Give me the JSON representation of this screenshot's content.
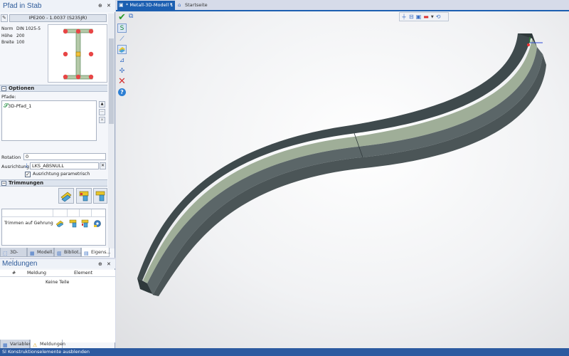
{
  "left_panel": {
    "title": "Pfad in Stab",
    "pin_glyph": "⊕",
    "close_glyph": "✕",
    "profile_name": "IPE200 - 1.0037 (S235JR)",
    "properties": [
      {
        "label": "Norm",
        "value": "DIN 1025-5"
      },
      {
        "label": "Höhe",
        "value": "200"
      },
      {
        "label": "Breite",
        "value": "100"
      }
    ],
    "options_header": "Optionen",
    "paths_label": "Pfade:",
    "paths": [
      "3D-Pfad_1"
    ],
    "rotation_label": "Rotation",
    "rotation_value": "0",
    "alignment_label": "Ausrichtung",
    "alignment_value": "LKS_ABSNULL",
    "parametric_label": "Ausrichtung parametrisch",
    "parametric_checked": true,
    "trims_header": "Trimmungen",
    "trim_row_label": "Trimmen auf Gehrung",
    "tabs": [
      {
        "label": "3D-Mo..."
      },
      {
        "label": "Modell..."
      },
      {
        "label": "Bibliot..."
      },
      {
        "label": "Eigens..."
      }
    ]
  },
  "messages_panel": {
    "title": "Meldungen",
    "columns": [
      "#",
      "Meldung",
      "Element"
    ],
    "empty_text": "Keine Teile",
    "tabs": [
      {
        "label": "Variablen"
      },
      {
        "label": "Meldungen"
      }
    ]
  },
  "document_tabs": [
    {
      "label": "* Metall-3D-Modell 1",
      "close": "✕"
    },
    {
      "label": "Startseite"
    }
  ],
  "status_bar": {
    "text": "Konstruktionselemente ausblenden"
  },
  "colors": {
    "accent": "#2e5b9a",
    "active_tab": "#1c5fb1",
    "status_bar": "#2c5aa0",
    "beam_top": "#9fae98",
    "beam_side": "#3f4a4d"
  },
  "icons": {
    "confirm": "checkmark-icon",
    "cancel": "cross-icon",
    "help": "help-icon"
  }
}
